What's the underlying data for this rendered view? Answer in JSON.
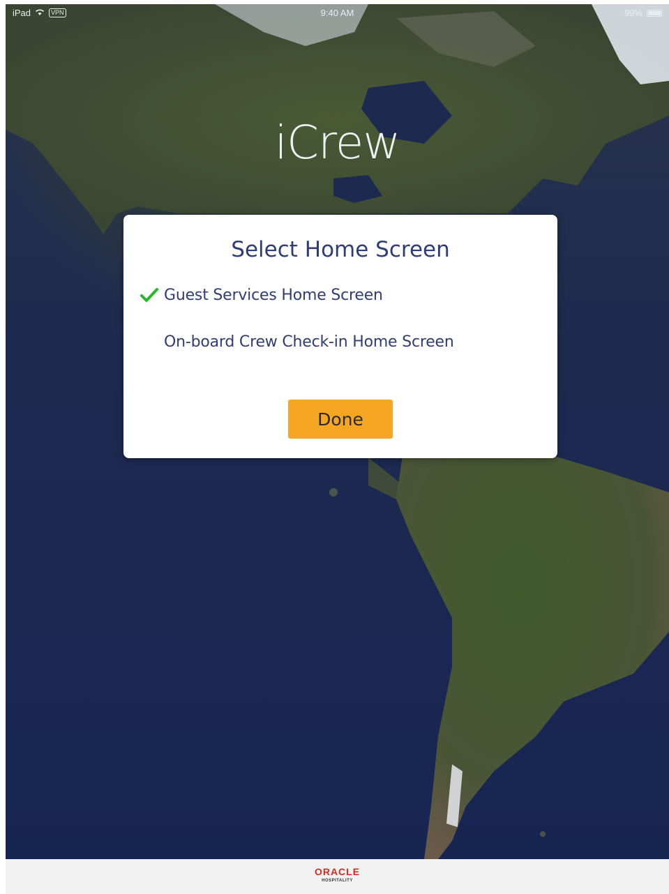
{
  "status_bar": {
    "device": "iPad",
    "vpn": "VPN",
    "time": "9:40 AM",
    "battery": "99%",
    "battery_level": 0.99,
    "icons": [
      "wifi-icon",
      "vpn-icon",
      "battery-icon"
    ]
  },
  "app": {
    "title": "iCrew"
  },
  "dialog": {
    "title": "Select Home Screen",
    "options": [
      {
        "label": "Guest Services Home Screen",
        "selected": true
      },
      {
        "label": "On-board Crew Check-in Home Screen",
        "selected": false
      }
    ],
    "done_label": "Done",
    "check_color": "#2ab52a",
    "done_color": "#f5a623"
  },
  "footer": {
    "brand": "ORACLE",
    "sub": "HOSPITALITY"
  }
}
